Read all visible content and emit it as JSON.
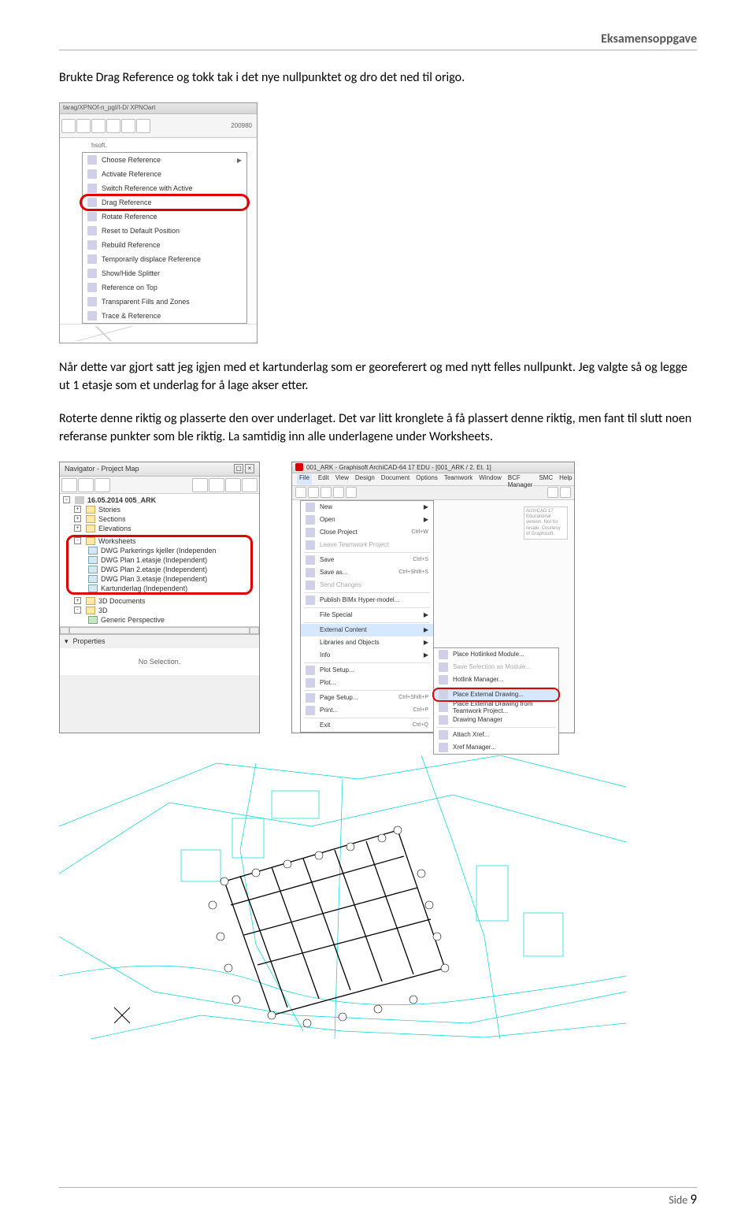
{
  "header": {
    "title": "Eksamensoppgave"
  },
  "paragraphs": {
    "p1": "Brukte Drag Reference og tokk tak i det nye nullpunktet og dro det ned til origo.",
    "p2": "Når dette var gjort satt jeg igjen med et kartunderlag som er georeferert og med nytt felles nullpunkt. Jeg valgte så og legge ut 1 etasje som et underlag for å lage akser etter.",
    "p3": "Roterte denne riktig og plasserte den over underlaget. Det var litt kronglete å få plassert denne riktig, men fant til slutt noen referanse punkter som ble riktig. La samtidig inn alle underlagene under Worksheets."
  },
  "ctx": {
    "title": "tarag/XPNOf-n_pgI/I-D/ XPNOart",
    "number": "200980",
    "small": "hsoft.",
    "items": [
      "Choose Reference",
      "Activate Reference",
      "Switch Reference with Active",
      "Drag Reference",
      "Rotate Reference",
      "Reset to Default Position",
      "Rebuild Reference",
      "Temporarily displace Reference",
      "Show/Hide Splitter",
      "Reference on Top",
      "Transparent Fills and Zones",
      "Trace & Reference"
    ],
    "highlight_index": 3
  },
  "nav": {
    "title": "Navigator - Project Map",
    "root": "16.05.2014 005_ARK",
    "folders": [
      "Stories",
      "Sections",
      "Elevations"
    ],
    "worksheets_label": "Worksheets",
    "worksheets": [
      "DWG Parkerings kjeller (Independen",
      "DWG Plan 1.etasje (Independent)",
      "DWG Plan 2.etasje (Independent)",
      "DWG Plan 3.etasje (Independent)",
      "Kartunderlag (Independent)"
    ],
    "folders2": [
      "3D Documents",
      "3D",
      "Generic Perspective"
    ],
    "props": "Properties",
    "nosel": "No Selection."
  },
  "menu": {
    "title": "001_ARK - Graphisoft ArchiCAD-64 17 EDU - [001_ARK / 2. Et. 1]",
    "menubar": [
      "File",
      "Edit",
      "View",
      "Design",
      "Document",
      "Options",
      "Teamwork",
      "Window",
      "BCF Manager",
      "SMC",
      "Help"
    ],
    "corner": "ArchiCAD 17 Educational version. Not for resale. Courtesy of Graphisoft.",
    "items": [
      {
        "label": "New",
        "arrow": true
      },
      {
        "label": "Open",
        "arrow": true
      },
      {
        "label": "Close Project",
        "sc": "Ctrl+W"
      },
      {
        "label": "Leave Teamwork Project",
        "dim": true
      },
      {
        "label": "Save",
        "sc": "Ctrl+S"
      },
      {
        "label": "Save as...",
        "sc": "Ctrl+Shift+S"
      },
      {
        "label": "Send Changes",
        "dim": true
      },
      {
        "label": "Publish BIMx Hyper-model..."
      },
      {
        "label": "File Special",
        "arrow": true
      },
      {
        "label": "External Content",
        "arrow": true
      },
      {
        "label": "Libraries and Objects",
        "arrow": true
      },
      {
        "label": "Info",
        "arrow": true
      },
      {
        "label": "Plot Setup..."
      },
      {
        "label": "Plot..."
      },
      {
        "label": "Page Setup...",
        "sc": "Ctrl+Shift+P"
      },
      {
        "label": "Print...",
        "sc": "Ctrl+P"
      },
      {
        "label": "Exit",
        "sc": "Ctrl+Q"
      }
    ],
    "submenu": [
      "Place Hotlinked Module...",
      "Save Selection as Module...",
      "Hotlink Manager...",
      "Place External Drawing...",
      "Place External Drawing from Teamwork Project...",
      "Drawing Manager",
      "Attach Xref...",
      "Xref Manager..."
    ],
    "submenu_highlight_index": 3,
    "submenu_dim": [
      1
    ]
  },
  "footer": {
    "label": "Side",
    "num": "9"
  }
}
